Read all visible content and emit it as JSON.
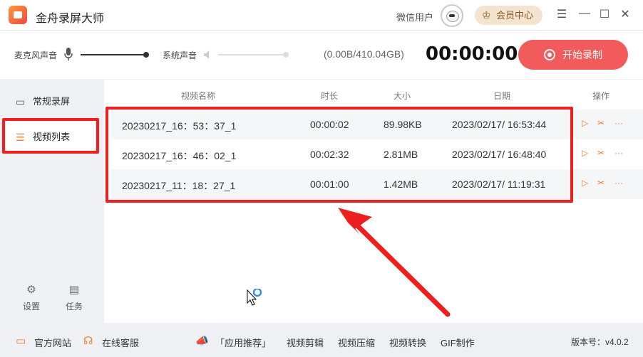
{
  "app": {
    "title": "金舟录屏大师"
  },
  "header": {
    "user_label": "微信用户",
    "vip_label": "会员中心",
    "icons": [
      "crown-icon",
      "menu-icon",
      "minimize-icon",
      "maximize-icon",
      "close-icon"
    ]
  },
  "controls": {
    "mic_label": "麦克风声音",
    "system_label": "系统声音",
    "mic_volume": 1.0,
    "system_volume": 0.0,
    "storage": "(0.00B/410.04GB)",
    "timer": "00:00:00",
    "record_label": "开始录制"
  },
  "sidebar": {
    "items": [
      {
        "label": "常规录屏",
        "icon": "camera-icon",
        "active": false
      },
      {
        "label": "视频列表",
        "icon": "list-icon",
        "active": true
      }
    ],
    "bottom": [
      {
        "label": "设置",
        "icon": "gear-icon"
      },
      {
        "label": "任务",
        "icon": "clipboard-icon"
      }
    ]
  },
  "table": {
    "columns": [
      "视频名称",
      "时长",
      "大小",
      "日期",
      "操作"
    ],
    "rows": [
      {
        "name": "20230217_16：53：37_1",
        "duration": "00:00:02",
        "size": "89.98KB",
        "date": "2023/02/17/ 16:53:44"
      },
      {
        "name": "20230217_16：46：02_1",
        "duration": "00:02:32",
        "size": "2.81MB",
        "date": "2023/02/17/ 16:48:40"
      },
      {
        "name": "20230217_11：18：27_1",
        "duration": "00:01:00",
        "size": "1.42MB",
        "date": "2023/02/17/ 11:19:31"
      }
    ],
    "row_actions": [
      "play-icon",
      "scissors-icon",
      "more-icon"
    ]
  },
  "footer": {
    "official_site": "官方网站",
    "online_service": "在线客服",
    "app_recommend": "「应用推荐」",
    "links": [
      "视频剪辑",
      "视频压缩",
      "视频转换",
      "GIF制作"
    ],
    "version": "版本号：v4.0.2"
  },
  "colors": {
    "accent": "#f25b5b",
    "highlight": "#ee1f1f",
    "action_orange": "#ee7b2e",
    "vip_bg": "#f3e3cf"
  }
}
